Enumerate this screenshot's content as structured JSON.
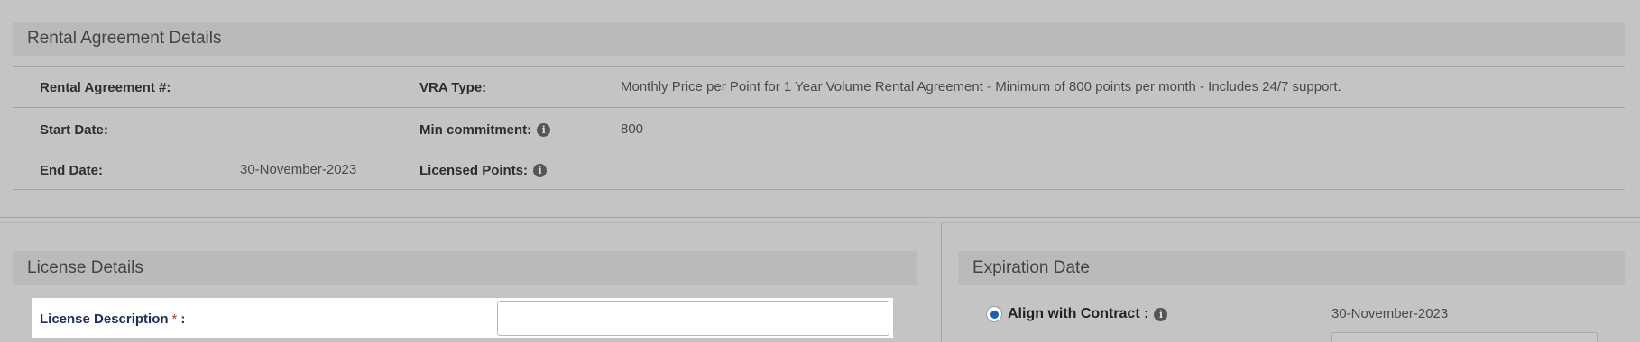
{
  "rental_section": {
    "title": "Rental Agreement Details",
    "rows": [
      {
        "label1": "Rental Agreement #:",
        "value1": "",
        "label2": "VRA Type:",
        "value2": "Monthly Price per Point for 1 Year Volume Rental Agreement - Minimum of 800 points per month - Includes 24/7 support."
      },
      {
        "label1": "Start Date:",
        "value1": "",
        "label2": "Min commitment:",
        "value2": "800"
      },
      {
        "label1": "End Date:",
        "value1": "30-November-2023",
        "label2": "Licensed Points:",
        "value2": ""
      }
    ]
  },
  "license_section": {
    "title": "License Details",
    "description_label": "License Description",
    "required_mark": "*",
    "colon": ":",
    "description_value": ""
  },
  "expiration_section": {
    "title": "Expiration Date",
    "align_label": "Align with Contract :",
    "align_date": "30-November-2023",
    "align_selected": true
  },
  "icons": {
    "info": "info-icon"
  },
  "colors": {
    "radio_accent": "#1a5fb4",
    "required": "#c0392b",
    "label_blue": "#1c2d5a"
  }
}
